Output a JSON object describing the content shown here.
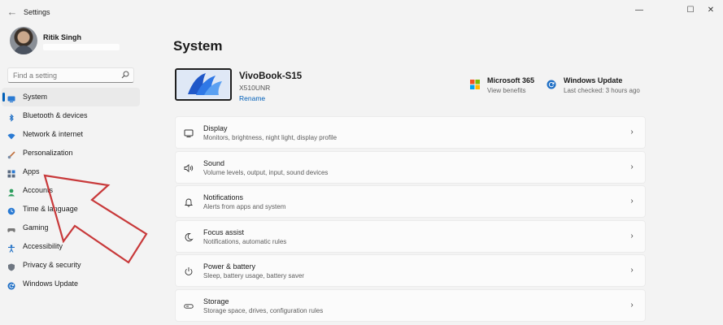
{
  "window": {
    "title": "Settings",
    "back_glyph": "←",
    "minimize_glyph": "—",
    "maximize_glyph": "☐",
    "close_glyph": "✕"
  },
  "profile": {
    "name": "Ritik Singh"
  },
  "search": {
    "placeholder": "Find a setting",
    "icon": "search-icon"
  },
  "nav": {
    "selected": "System",
    "items": [
      {
        "label": "System",
        "icon": "monitor-icon",
        "color": "#2a7ad3"
      },
      {
        "label": "Bluetooth & devices",
        "icon": "bluetooth-icon",
        "color": "#1f6fc5"
      },
      {
        "label": "Network & internet",
        "icon": "wifi-icon",
        "color": "#2a7ad3"
      },
      {
        "label": "Personalization",
        "icon": "brush-icon",
        "color": "#c0703c"
      },
      {
        "label": "Apps",
        "icon": "apps-icon",
        "color": "#5a6a80"
      },
      {
        "label": "Accounts",
        "icon": "person-icon",
        "color": "#2e9e5e"
      },
      {
        "label": "Time & language",
        "icon": "globe-clock-icon",
        "color": "#2a7ad3"
      },
      {
        "label": "Gaming",
        "icon": "gamepad-icon",
        "color": "#777777"
      },
      {
        "label": "Accessibility",
        "icon": "accessibility-icon",
        "color": "#1f6fc5"
      },
      {
        "label": "Privacy & security",
        "icon": "shield-icon",
        "color": "#6f7782"
      },
      {
        "label": "Windows Update",
        "icon": "update-icon",
        "color": "#1f6fc5"
      }
    ]
  },
  "main": {
    "title": "System",
    "device": {
      "name": "VivoBook-S15",
      "model": "X510UNR",
      "rename_label": "Rename"
    },
    "quick": [
      {
        "title": "Microsoft 365",
        "subtitle": "View benefits",
        "icon": "microsoft-logo-icon"
      },
      {
        "title": "Windows Update",
        "subtitle": "Last checked: 3 hours ago",
        "icon": "update-icon"
      }
    ],
    "cards": [
      {
        "title": "Display",
        "subtitle": "Monitors, brightness, night light, display profile",
        "icon": "display-icon"
      },
      {
        "title": "Sound",
        "subtitle": "Volume levels, output, input, sound devices",
        "icon": "speaker-icon"
      },
      {
        "title": "Notifications",
        "subtitle": "Alerts from apps and system",
        "icon": "bell-icon"
      },
      {
        "title": "Focus assist",
        "subtitle": "Notifications, automatic rules",
        "icon": "moon-icon"
      },
      {
        "title": "Power & battery",
        "subtitle": "Sleep, battery usage, battery saver",
        "icon": "power-icon"
      },
      {
        "title": "Storage",
        "subtitle": "Storage space, drives, configuration rules",
        "icon": "drive-icon"
      }
    ],
    "chevron_glyph": "›"
  },
  "colors": {
    "accent": "#005fb8",
    "annotation_arrow": "#c8393a"
  }
}
